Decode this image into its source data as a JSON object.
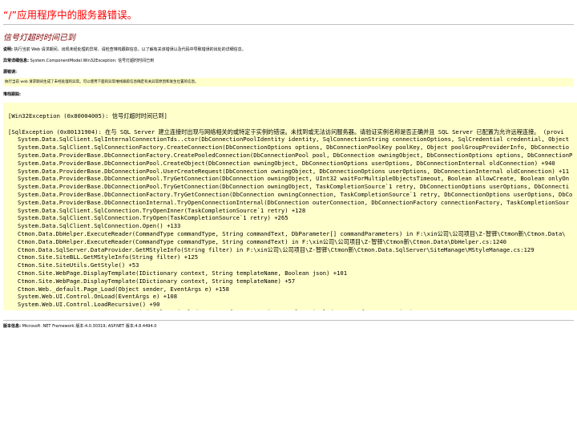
{
  "page": {
    "title": "“/”应用程序中的服务器错误。",
    "subtitle": "信号灯超时时间已到"
  },
  "description": {
    "label": "说明:",
    "text": " 执行当前 Web 请求期间，出现未经处理的异常。请检查堆栈跟踪信息，以了解有关该错误以及代码中导致错误的出处的详细信息。"
  },
  "exception_details": {
    "label": "异常详细信息:",
    "text": " System.ComponentModel.Win32Exception: 信号灯超时时间已到"
  },
  "source_error": {
    "label": "源错误:",
    "text": "执行当前 web 请求期间生成了未经处理的异常。可以使用下面的异常堆栈跟踪信息确定有关异常原因和发生位置的信息。"
  },
  "stack_trace": {
    "label": "堆栈跟踪:",
    "header": "[Win32Exception (0x80004005): 信号灯超时时间已到]",
    "sql_exception": "[SqlException (0x80131904): 在与 SQL Server 建立连接时出现与网络相关的或特定于实例的错误。未找到或无法访问服务器。请验证实例名称是否正确并且 SQL Server 已配置为允许远程连接。 (provi",
    "frames": [
      "System.Data.SqlClient.SqlInternalConnectionTds..ctor(DbConnectionPoolIdentity identity, SqlConnectionString connectionOptions, SqlCredential credential, Object",
      "System.Data.SqlClient.SqlConnectionFactory.CreateConnection(DbConnectionOptions options, DbConnectionPoolKey poolKey, Object poolGroupProviderInfo, DbConnectio",
      "System.Data.ProviderBase.DbConnectionFactory.CreatePooledConnection(DbConnectionPool pool, DbConnection owningObject, DbConnectionOptions options, DbConnectionP",
      "System.Data.ProviderBase.DbConnectionPool.CreateObject(DbConnection owningObject, DbConnectionOptions userOptions, DbConnectionInternal oldConnection) +940",
      "System.Data.ProviderBase.DbConnectionPool.UserCreateRequest(DbConnection owningObject, DbConnectionOptions userOptions, DbConnectionInternal oldConnection) +11",
      "System.Data.ProviderBase.DbConnectionPool.TryGetConnection(DbConnection owningObject, UInt32 waitForMultipleObjectsTimeout, Boolean allowCreate, Boolean onlyOn",
      "System.Data.ProviderBase.DbConnectionPool.TryGetConnection(DbConnection owningObject, TaskCompletionSource`1 retry, DbConnectionOptions userOptions, DbConnecti",
      "System.Data.ProviderBase.DbConnectionFactory.TryGetConnection(DbConnection owningConnection, TaskCompletionSource`1 retry, DbConnectionOptions userOptions, DbCo",
      "System.Data.ProviderBase.DbConnectionInternal.TryOpenConnectionInternal(DbConnection outerConnection, DbConnectionFactory connectionFactory, TaskCompletionSour",
      "System.Data.SqlClient.SqlConnection.TryOpenInner(TaskCompletionSource`1 retry) +128",
      "System.Data.SqlClient.SqlConnection.TryOpen(TaskCompletionSource`1 retry) +265",
      "System.Data.SqlClient.SqlConnection.Open() +133",
      "Ctmon.Data.DbHelper.ExecuteReader(CommandType commandType, String commandText, DbParameter[] commandParameters) in F:\\xin公司\\公司项目\\Z-智驿\\Ctmon新\\Ctmon.Data\\",
      "Ctmon.Data.DbHelper.ExecuteReader(CommandType commandType, String commandText) in F:\\xin公司\\公司项目\\Z-智驿\\Ctmon新\\Ctmon.Data\\DbHelper.cs:1240",
      "Ctmon.Data.SqlServer.DataProvider.GetMStyleInfo(String filter) in F:\\xin公司\\公司项目\\Z-智驿\\Ctmon新\\Ctmon.Data.SqlServer\\SiteManage\\MStyleManage.cs:129",
      "Ctmon.Site.SiteBLL.GetMStyleInfo(String filter) +125",
      "Ctmon.Site.SiteUtils.GetStyle() +53",
      "Ctmon.Site.WebPage.DisplayTemplate(IDictionary context, String templateName, Boolean json) +101",
      "Ctmon.Site.WebPage.DisplayTemplate(IDictionary context, String templateName) +57",
      "Ctmon.Web._default.Page_Load(Object sender, EventArgs e) +158",
      "System.Web.UI.Control.OnLoad(EventArgs e) +108",
      "System.Web.UI.Control.LoadRecursive() +90",
      "System.Web.UI.Page.ProcessRequestMain(Boolean includeStagesBeforeAsyncPoint, Boolean includeStagesAfterAsyncPoint) +1533"
    ]
  },
  "version_info": {
    "label": "版本信息:",
    "text": " Microsoft .NET Framework 版本:4.0.30319; ASP.NET 版本:4.8.4494.0"
  },
  "colors": {
    "title": "#ff0000",
    "subtitle": "#800000",
    "code_background": "#ffffcc",
    "rule": "#c0c0c0"
  }
}
